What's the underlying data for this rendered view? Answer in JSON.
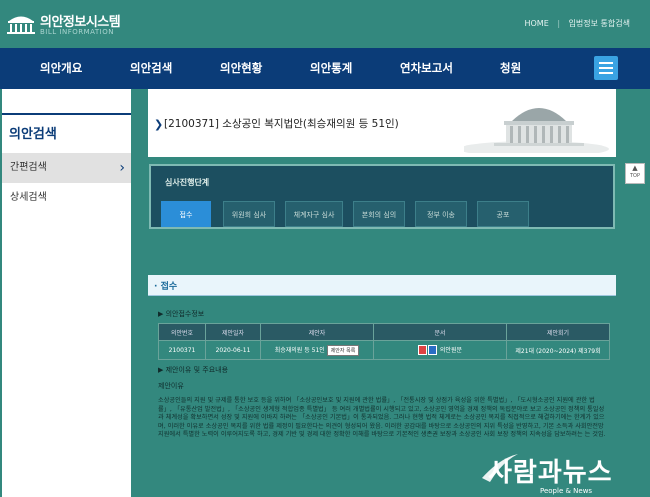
{
  "header": {
    "logo_title": "의안정보시스템",
    "logo_sub": "BILL INFORMATION",
    "links": [
      "HOME",
      "입법정보 통합검색"
    ]
  },
  "nav": {
    "items": [
      "의안개요",
      "의안검색",
      "의안현황",
      "의안통계",
      "연차보고서",
      "청원"
    ],
    "menu_icon": "hamburger-icon"
  },
  "sidebar": {
    "title": "의안검색",
    "items": [
      {
        "label": "간편검색",
        "active": true
      },
      {
        "label": "상세검색",
        "active": false
      }
    ]
  },
  "bill": {
    "title": "[2100371] 소상공인 복지법안(최승재의원 등 51인)"
  },
  "stages": {
    "title": "심사진행단계",
    "steps": [
      "접수",
      "위원회 심사",
      "체계자구 심사",
      "본회의 심의",
      "정부 이송",
      "공포"
    ],
    "active_index": 0
  },
  "top_button": "TOP",
  "section": {
    "title": "접수",
    "info_title": "▶ 의안접수정보",
    "columns": [
      "의안번호",
      "제안일자",
      "제안자",
      "문서",
      "제안회기"
    ],
    "row": {
      "bill_no": "2100371",
      "date": "2020-06-11",
      "proposer": "최승재의원 등 51인",
      "proposer_btn": "제안자 목록",
      "doc": "의안원문",
      "session": "제21대 (2020~2024) 제379회"
    },
    "reason_head": "▶ 제안이유 및 주요내용",
    "reason_label": "제안이유",
    "reason_text": "소상공인들의 지원 및 규제를 통한 보호 등을 위하여 「소상공인보호 및 지원에 관한 법률」, 「전통시장 및 상점가 육성을 위한 특별법」, 「도시형소공인 지원에 관한 법률」, 「유통산업 발전법」, 「소상공인 생계형 적합업종 특별법」 등 여러 개별법률이 시행되고 있고, 소상공인 영역을 경제 정책의 독립분야로 보고 소상공인 정책의 통일성과 체계성을 확보하면서 성장 및 지원에 이바지 하려는 「소상공인 기본법」이 통과되었음. 그러나 현행 법적 체계로는 소상공인 복지를 직접적으로 해결하기에는 한계가 있으며, 이러한 이유로 소상공인 복지를 위한 법률 제정이 필요한다는 의견이 형성되어 왔음. 이러한 공감대를 바탕으로 소상공인의 지위 특성을 반영하고, 기본 소득과 사회안전망 지원에서 특별한 노력이 이루어지도록 하고, 경제 기반 및 경제 대한 정확한 이해를 바탕으로 기본적인 생존권 보장과 소상공인 사회 보장 정책의 지속성을 담보하려는 는 것임."
  },
  "watermark": {
    "text": "사람과뉴스",
    "sub": "People & News"
  }
}
